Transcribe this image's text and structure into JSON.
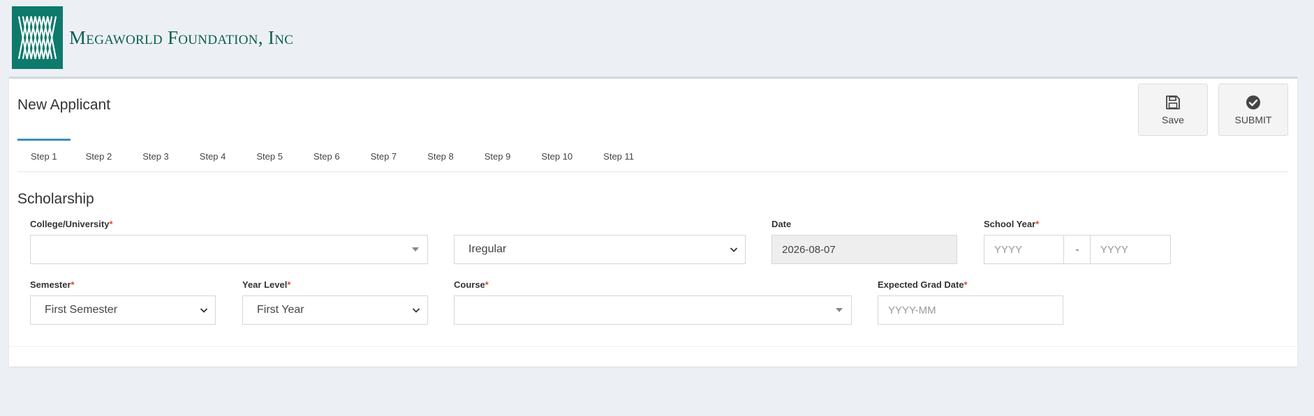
{
  "brand": {
    "name": "Megaworld Foundation, Inc"
  },
  "page": {
    "title": "New Applicant"
  },
  "actions": {
    "save_label": "Save",
    "submit_label": "SUBMIT"
  },
  "tabs": [
    {
      "label": "Step 1",
      "active": true
    },
    {
      "label": "Step 2"
    },
    {
      "label": "Step 3"
    },
    {
      "label": "Step 4"
    },
    {
      "label": "Step 5"
    },
    {
      "label": "Step 6"
    },
    {
      "label": "Step 7"
    },
    {
      "label": "Step 8"
    },
    {
      "label": "Step 9"
    },
    {
      "label": "Step 10"
    },
    {
      "label": "Step 11"
    }
  ],
  "section": {
    "title": "Scholarship"
  },
  "form": {
    "college": {
      "label": "College/University",
      "required": "*",
      "value": ""
    },
    "status": {
      "value": "Iregular"
    },
    "date": {
      "label": "Date",
      "value": "2026-08-07"
    },
    "school_year": {
      "label": "School Year",
      "required": "*",
      "from_placeholder": "YYYY",
      "separator": "-",
      "to_placeholder": "YYYY"
    },
    "semester": {
      "label": "Semester",
      "required": "*",
      "value": "First Semester"
    },
    "year_level": {
      "label": "Year Level",
      "required": "*",
      "value": "First Year"
    },
    "course": {
      "label": "Course",
      "required": "*",
      "value": ""
    },
    "expected_grad": {
      "label": "Expected Grad Date",
      "required": "*",
      "placeholder": "YYYY-MM"
    }
  },
  "colors": {
    "brand_green": "#0e7a6b",
    "accent_blue": "#3c8dbc",
    "required_red": "#dd4b39"
  }
}
